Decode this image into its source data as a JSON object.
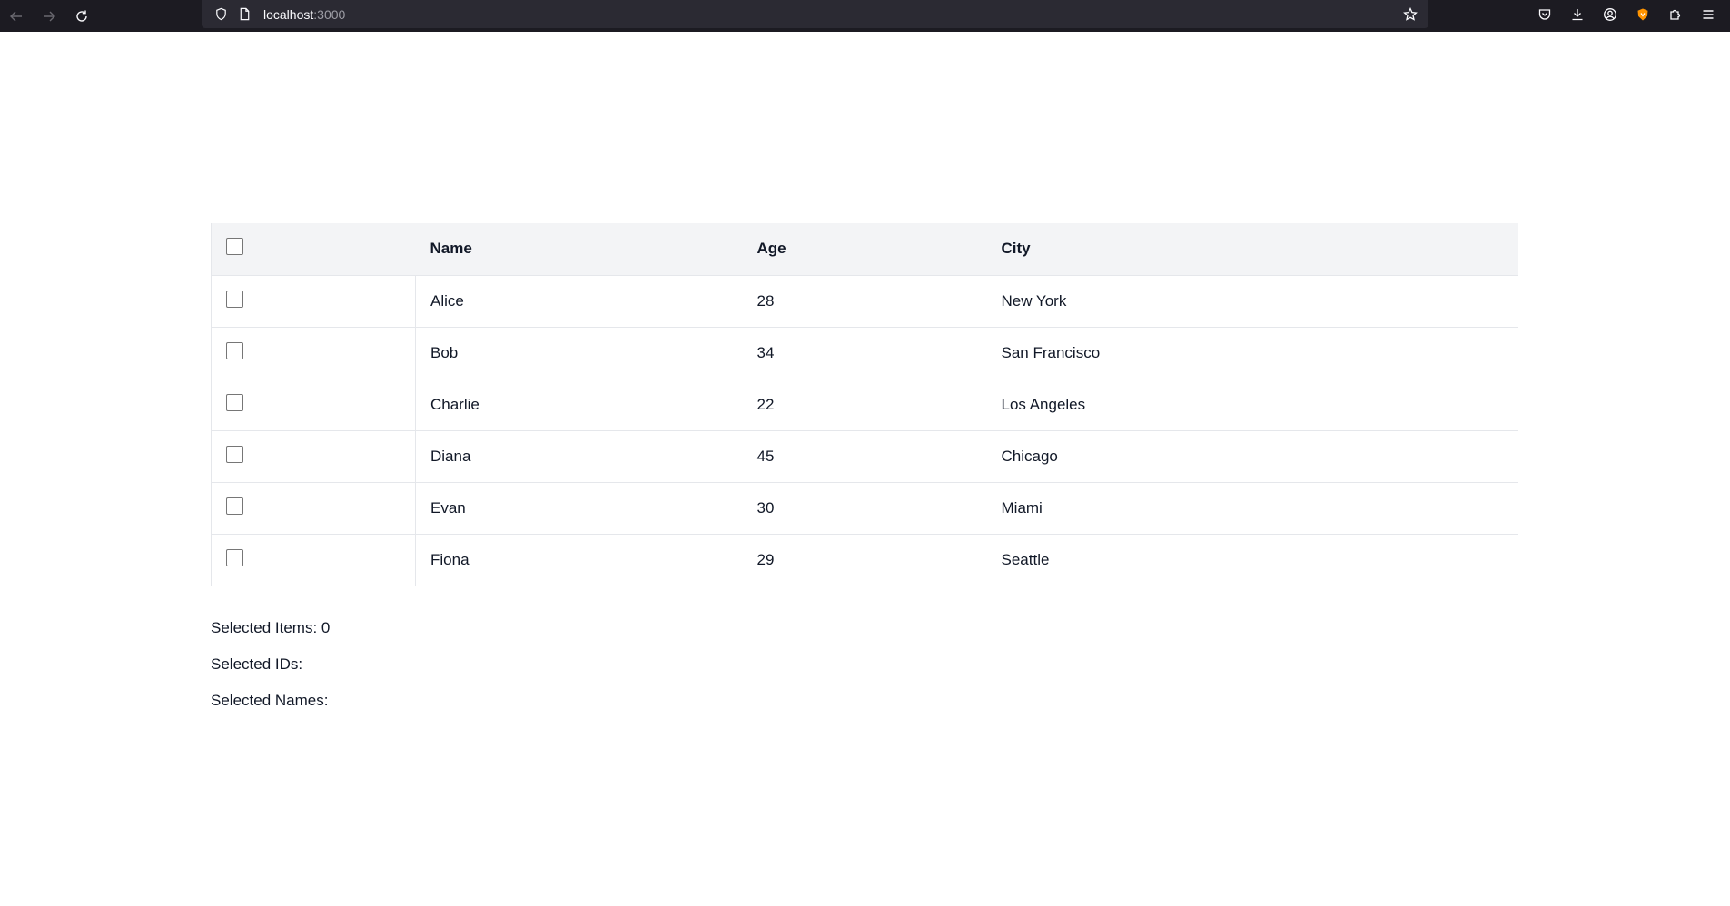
{
  "browser": {
    "url_host": "localhost",
    "url_port": ":3000",
    "icons": {
      "back": "arrow-left-icon",
      "forward": "arrow-right-icon",
      "reload": "reload-icon",
      "tracking": "shield-icon",
      "page": "page-icon",
      "bookmark": "star-icon",
      "pocket": "pocket-icon",
      "downloads": "download-icon",
      "account": "account-icon",
      "extension": "extension-icon",
      "extensions": "puzzle-icon",
      "menu": "hamburger-menu-icon"
    }
  },
  "table": {
    "columns": {
      "name": "Name",
      "age": "Age",
      "city": "City"
    },
    "rows": [
      {
        "name": "Alice",
        "age": "28",
        "city": "New York",
        "checked": false
      },
      {
        "name": "Bob",
        "age": "34",
        "city": "San Francisco",
        "checked": false
      },
      {
        "name": "Charlie",
        "age": "22",
        "city": "Los Angeles",
        "checked": false
      },
      {
        "name": "Diana",
        "age": "45",
        "city": "Chicago",
        "checked": false
      },
      {
        "name": "Evan",
        "age": "30",
        "city": "Miami",
        "checked": false
      },
      {
        "name": "Fiona",
        "age": "29",
        "city": "Seattle",
        "checked": false
      }
    ]
  },
  "summary": {
    "selected_items": "Selected Items: 0",
    "selected_ids": "Selected IDs:",
    "selected_names": "Selected Names:"
  },
  "colors": {
    "chrome_bg": "#1c1b22",
    "urlbar_bg": "#2b2a33",
    "header_bg": "#f3f4f6",
    "border": "#e5e7eb",
    "extension_accent": "#ff9400"
  }
}
